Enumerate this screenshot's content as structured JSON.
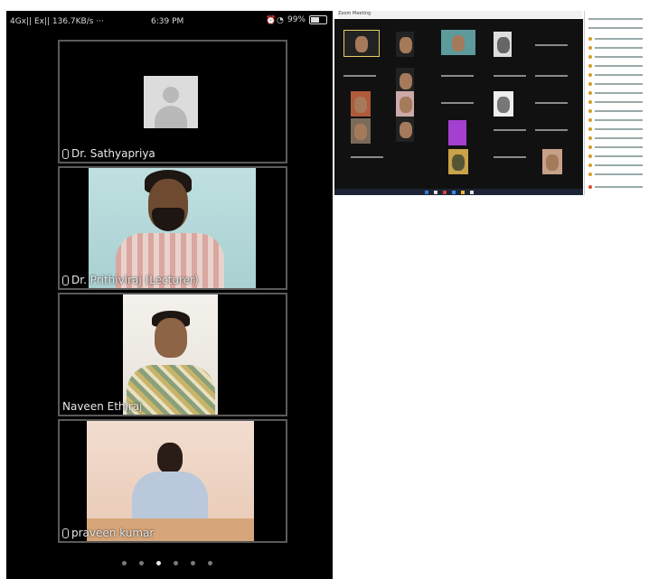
{
  "phone": {
    "status_left": "4Gx|| Ex|| 136.7KB/s ···",
    "status_time": "6:39 PM",
    "status_battery": "99%",
    "participants": [
      {
        "name": "Dr. Sathyapriya",
        "has_video": false
      },
      {
        "name": "Dr. Prithiviraj (Lecturer)",
        "has_video": true
      },
      {
        "name": "Naveen Ethiraj",
        "has_video": true
      },
      {
        "name": "praveen kumar",
        "has_video": true
      }
    ],
    "pages": 6,
    "active_page": 3
  },
  "desktop": {
    "title": "Zoom Meeting"
  },
  "colors": {
    "background": "#000000",
    "tile_border": "#5a5a5a",
    "text": "#e8e8e8"
  }
}
